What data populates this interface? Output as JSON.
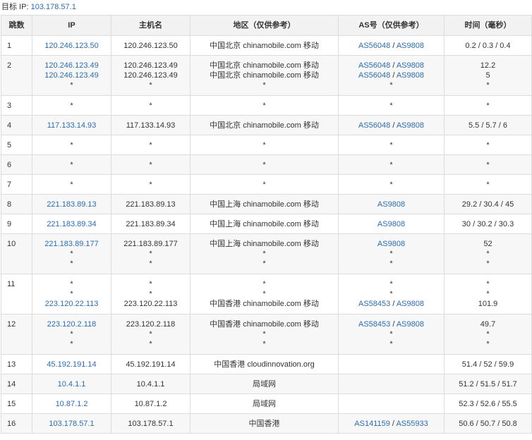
{
  "target": {
    "label": "目标 IP:",
    "ip": "103.178.57.1"
  },
  "columns": [
    "跳数",
    "IP",
    "主机名",
    "地区（仅供参考）",
    "AS号（仅供参考）",
    "时间（毫秒）"
  ],
  "rows": [
    {
      "hop": "1",
      "lines": [
        {
          "ip": "120.246.123.50",
          "host": "120.246.123.50",
          "region": "中国北京 chinamobile.com 移动",
          "as": [
            "AS56048",
            "AS9808"
          ],
          "time": "0.2 / 0.3 / 0.4"
        }
      ]
    },
    {
      "hop": "2",
      "lines": [
        {
          "ip": "120.246.123.49",
          "host": "120.246.123.49",
          "region": "中国北京 chinamobile.com 移动",
          "as": [
            "AS56048",
            "AS9808"
          ],
          "time": "12.2"
        },
        {
          "ip": "120.246.123.49",
          "host": "120.246.123.49",
          "region": "中国北京 chinamobile.com 移动",
          "as": [
            "AS56048",
            "AS9808"
          ],
          "time": "5"
        },
        {
          "ip": "*",
          "host": "*",
          "region": "*",
          "as": [
            "*"
          ],
          "time": "*"
        }
      ]
    },
    {
      "hop": "3",
      "lines": [
        {
          "ip": "*",
          "host": "*",
          "region": "*",
          "as": [
            "*"
          ],
          "time": "*"
        }
      ]
    },
    {
      "hop": "4",
      "lines": [
        {
          "ip": "117.133.14.93",
          "host": "117.133.14.93",
          "region": "中国北京 chinamobile.com 移动",
          "as": [
            "AS56048",
            "AS9808"
          ],
          "time": "5.5 / 5.7 / 6"
        }
      ]
    },
    {
      "hop": "5",
      "lines": [
        {
          "ip": "*",
          "host": "*",
          "region": "*",
          "as": [
            "*"
          ],
          "time": "*"
        }
      ]
    },
    {
      "hop": "6",
      "lines": [
        {
          "ip": "*",
          "host": "*",
          "region": "*",
          "as": [
            "*"
          ],
          "time": "*"
        }
      ]
    },
    {
      "hop": "7",
      "lines": [
        {
          "ip": "*",
          "host": "*",
          "region": "*",
          "as": [
            "*"
          ],
          "time": "*"
        }
      ]
    },
    {
      "hop": "8",
      "lines": [
        {
          "ip": "221.183.89.13",
          "host": "221.183.89.13",
          "region": "中国上海 chinamobile.com 移动",
          "as": [
            "AS9808"
          ],
          "time": "29.2 / 30.4 / 45"
        }
      ]
    },
    {
      "hop": "9",
      "lines": [
        {
          "ip": "221.183.89.34",
          "host": "221.183.89.34",
          "region": "中国上海 chinamobile.com 移动",
          "as": [
            "AS9808"
          ],
          "time": "30 / 30.2 / 30.3"
        }
      ]
    },
    {
      "hop": "10",
      "lines": [
        {
          "ip": "221.183.89.177",
          "host": "221.183.89.177",
          "region": "中国上海 chinamobile.com 移动",
          "as": [
            "AS9808"
          ],
          "time": "52"
        },
        {
          "ip": "*",
          "host": "*",
          "region": "*",
          "as": [
            "*"
          ],
          "time": "*"
        },
        {
          "ip": "*",
          "host": "*",
          "region": "*",
          "as": [
            "*"
          ],
          "time": "*"
        }
      ]
    },
    {
      "hop": "11",
      "lines": [
        {
          "ip": "*",
          "host": "*",
          "region": "*",
          "as": [
            "*"
          ],
          "time": "*"
        },
        {
          "ip": "*",
          "host": "*",
          "region": "*",
          "as": [
            "*"
          ],
          "time": "*"
        },
        {
          "ip": "223.120.22.113",
          "host": "223.120.22.113",
          "region": "中国香港 chinamobile.com 移动",
          "as": [
            "AS58453",
            "AS9808"
          ],
          "time": "101.9"
        }
      ]
    },
    {
      "hop": "12",
      "lines": [
        {
          "ip": "223.120.2.118",
          "host": "223.120.2.118",
          "region": "中国香港 chinamobile.com 移动",
          "as": [
            "AS58453",
            "AS9808"
          ],
          "time": "49.7"
        },
        {
          "ip": "*",
          "host": "*",
          "region": "*",
          "as": [
            "*"
          ],
          "time": "*"
        },
        {
          "ip": "*",
          "host": "*",
          "region": "*",
          "as": [
            "*"
          ],
          "time": "*"
        }
      ]
    },
    {
      "hop": "13",
      "lines": [
        {
          "ip": "45.192.191.14",
          "host": "45.192.191.14",
          "region": "中国香港 cloudinnovation.org",
          "as": [],
          "time": "51.4 / 52 / 59.9"
        }
      ]
    },
    {
      "hop": "14",
      "lines": [
        {
          "ip": "10.4.1.1",
          "host": "10.4.1.1",
          "region": "局域网",
          "as": [],
          "time": "51.2 / 51.5 / 51.7"
        }
      ]
    },
    {
      "hop": "15",
      "lines": [
        {
          "ip": "10.87.1.2",
          "host": "10.87.1.2",
          "region": "局域网",
          "as": [],
          "time": "52.3 / 52.6 / 55.5"
        }
      ]
    },
    {
      "hop": "16",
      "lines": [
        {
          "ip": "103.178.57.1",
          "host": "103.178.57.1",
          "region": "中国香港",
          "as": [
            "AS141159",
            "AS55933"
          ],
          "time": "50.6 / 50.7 / 50.8"
        }
      ]
    }
  ]
}
